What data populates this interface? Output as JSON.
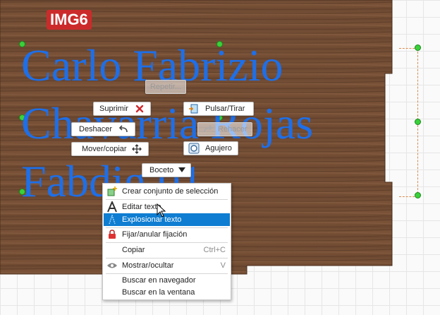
{
  "image_tag": "IMG6",
  "sketch_text": {
    "line1": "Carlo Fabrizio",
    "line2": "Chavarria Rojas",
    "line3": "Fabdig 01"
  },
  "marking_menu": {
    "repeat": "Repetir...",
    "delete": "Suprimir",
    "press_pull": "Pulsar/Tirar",
    "undo": "Deshacer",
    "redo": "Rehacer",
    "move_copy": "Mover/copiar",
    "hole": "Agujero",
    "sketch": "Boceto"
  },
  "context_menu": {
    "items": [
      {
        "label": "Crear conjunto de selección",
        "icon": "selection-set-icon",
        "shortcut": ""
      },
      {
        "label": "Editar texto",
        "icon": "text-a-icon",
        "shortcut": ""
      },
      {
        "label": "Explosionar texto",
        "icon": "explode-text-icon",
        "shortcut": ""
      },
      {
        "label": "Fijar/anular fijación",
        "icon": "lock-icon",
        "shortcut": ""
      },
      {
        "label": "Copiar",
        "icon": "",
        "shortcut": "Ctrl+C"
      },
      {
        "label": "Mostrar/ocultar",
        "icon": "eye-icon",
        "shortcut": "V"
      },
      {
        "label": "Buscar en navegador",
        "icon": "",
        "shortcut": ""
      },
      {
        "label": "Buscar en la ventana",
        "icon": "",
        "shortcut": ""
      }
    ],
    "highlighted_index": 2
  },
  "colors": {
    "text_blue": "#1e6fe8",
    "highlight": "#0f7dd1",
    "delete_red": "#d0282e",
    "handle_green": "#3bd13b"
  }
}
